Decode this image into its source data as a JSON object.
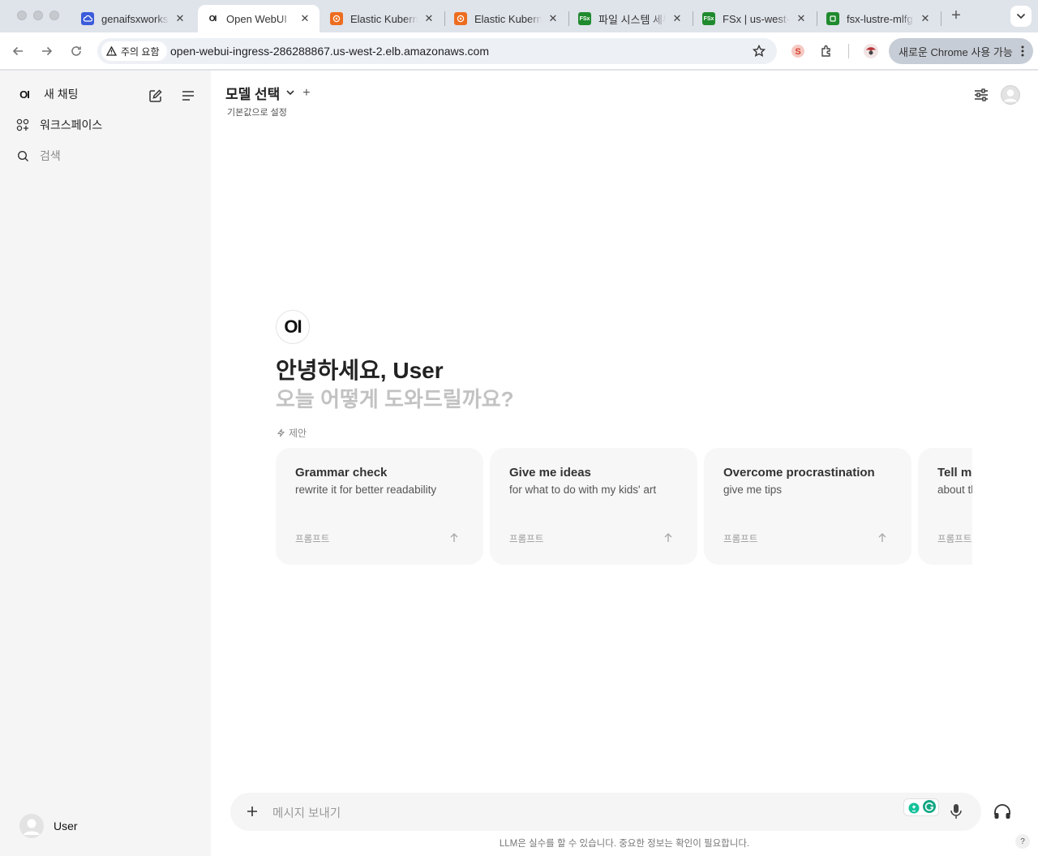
{
  "browser": {
    "tabs": [
      {
        "title": "genaifsxworks",
        "favicon": "cloud-icon",
        "color": "#3b5bdb"
      },
      {
        "title": "Open WebUI",
        "favicon": "openwebui-icon",
        "color": "#111111"
      },
      {
        "title": "Elastic Kubern",
        "favicon": "eks-icon",
        "color": "#ed6d1f"
      },
      {
        "title": "Elastic Kubern",
        "favicon": "eks-icon",
        "color": "#ed6d1f"
      },
      {
        "title": "파일 시스템 세부",
        "favicon": "fsx-icon",
        "color": "#1f8a2e"
      },
      {
        "title": "FSx | us-west-",
        "favicon": "fsx-icon",
        "color": "#1f8a2e"
      },
      {
        "title": "fsx-lustre-mlfg",
        "favicon": "s3-icon",
        "color": "#1f8a2e"
      }
    ],
    "security_chip": "주의 요함",
    "url": "open-webui-ingress-286288867.us-west-2.elb.amazonaws.com",
    "update_label": "새로운 Chrome 사용 가능"
  },
  "sidebar": {
    "logo": "OI",
    "new_chat": "새 채팅",
    "workspace": "워크스페이스",
    "search": "검색",
    "user": "User"
  },
  "header": {
    "model_select": "모델 선택",
    "set_default": "기본값으로 설정"
  },
  "hero": {
    "logo": "OI",
    "greeting": "안녕하세요, User",
    "subtitle": "오늘 어떻게 도와드릴까요?",
    "suggest_label": "제안"
  },
  "suggestions": [
    {
      "title": "Grammar check",
      "subtitle": "rewrite it for better readability",
      "label": "프롬프트"
    },
    {
      "title": "Give me ideas",
      "subtitle": "for what to do with my kids' art",
      "label": "프롬프트"
    },
    {
      "title": "Overcome procrastination",
      "subtitle": "give me tips",
      "label": "프롬프트"
    },
    {
      "title": "Tell me",
      "subtitle": "about th",
      "label": "프롬프트"
    }
  ],
  "composer": {
    "placeholder": "메시지 보내기"
  },
  "footer": {
    "disclaimer": "LLM은 실수를 할 수 있습니다. 중요한 정보는 확인이 필요합니다.",
    "help": "?"
  }
}
